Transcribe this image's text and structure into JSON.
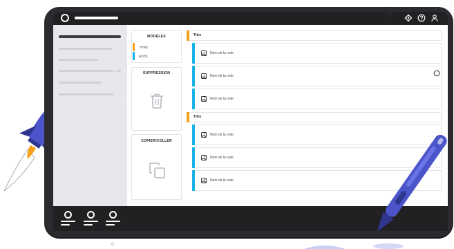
{
  "templates_panel": {
    "title": "MODÈLES",
    "items": [
      {
        "label": "TITRE",
        "color": "#f3a11b"
      },
      {
        "label": "NOTE",
        "color": "#17b3e8"
      }
    ]
  },
  "delete_panel": {
    "title": "SUPPRESSION",
    "icon": "trash-icon"
  },
  "copy_panel": {
    "title": "COPIER/COLLER",
    "icon": "copy-icon"
  },
  "board": {
    "sections": [
      {
        "title": "Titre",
        "notes": [
          "Nom de la note",
          "Nom de la note",
          "Nom de la note"
        ]
      },
      {
        "title": "Titre",
        "notes": [
          "Nom de la note",
          "Nom de la note",
          "Nom de la note"
        ]
      }
    ]
  },
  "topbar": {
    "icons": [
      "settings-icon",
      "help-icon",
      "user-icon"
    ]
  },
  "colors": {
    "title_accent": "#f3a11b",
    "note_accent": "#17b3e8",
    "chrome": "#212124"
  }
}
